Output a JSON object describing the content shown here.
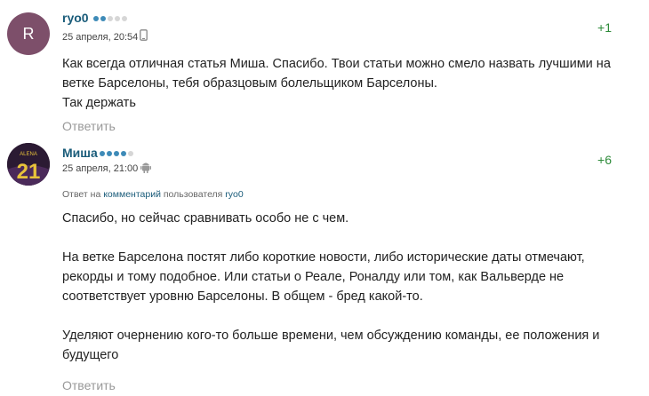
{
  "comments": [
    {
      "avatar_letter": "R",
      "author": "ryo0",
      "rating_dots": [
        true,
        true,
        false,
        false,
        false
      ],
      "date": "25 апреля, 20:54",
      "device_icon": "mobile-phone-icon",
      "score": "+1",
      "text_lines": [
        "Как всегда отличная статья Миша. Спасибо. Твои статьи можно смело назвать лучшими на",
        "ветке Барселоны, тебя образцовым болельщиком Барселоны.",
        "Так держать"
      ],
      "reply_label": "Ответить"
    },
    {
      "avatar_number": "21",
      "avatar_name": "ALENA",
      "author": "Миша",
      "rating_dots": [
        true,
        true,
        true,
        true,
        false
      ],
      "date": "25 апреля, 21:00",
      "device_icon": "android-icon",
      "score": "+6",
      "reply_to": {
        "prefix": "Ответ на",
        "link": "комментарий",
        "middle": "пользователя",
        "user": "ryo0"
      },
      "text_lines": [
        "Спасибо, но сейчас сравнивать особо не с чем.",
        "",
        "На ветке Барселона постят либо короткие новости, либо исторические даты отмечают,",
        "рекорды и тому подобное. Или статьи о Реале, Роналду или том, как Вальверде не",
        "соответствует уровню Барселоны. В общем - бред какой-то.",
        "",
        "Уделяют очернению кого-то больше времени, чем обсуждению команды, ее положения и",
        "будущего"
      ],
      "reply_label": "Ответить"
    }
  ]
}
